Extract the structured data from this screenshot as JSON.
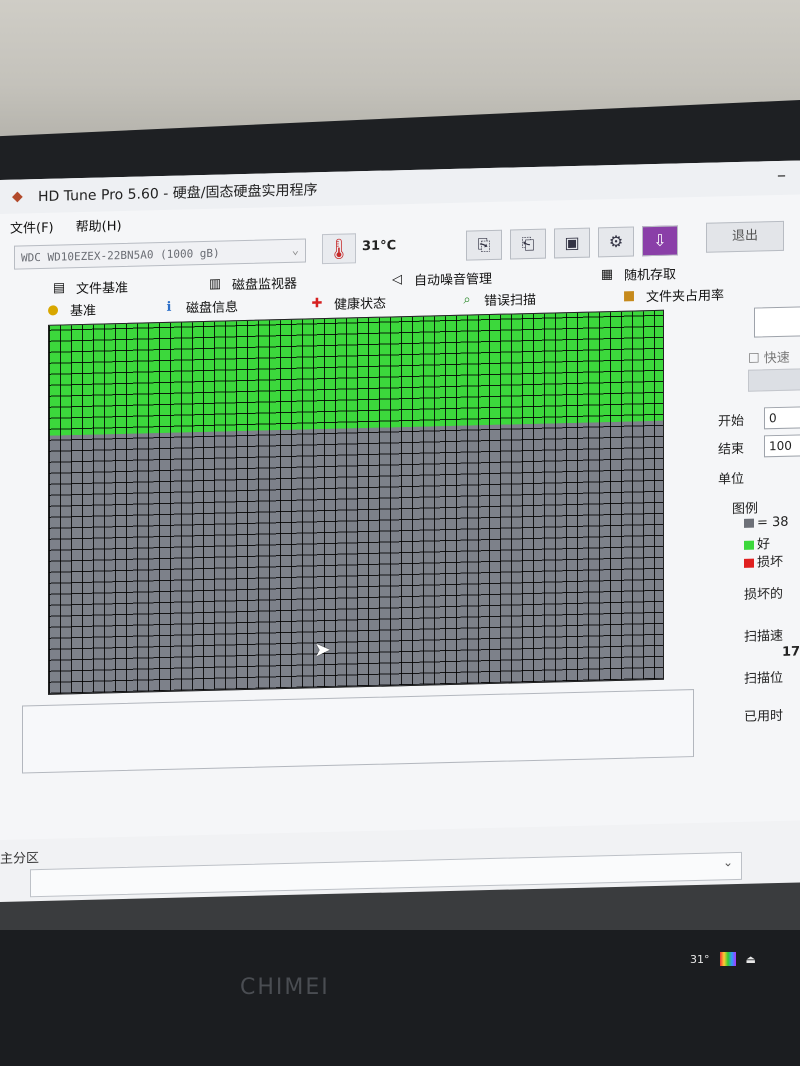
{
  "window": {
    "title": "HD Tune Pro 5.60 - 硬盘/固态硬盘实用程序",
    "menu": [
      "文件(F)",
      "帮助(H)"
    ]
  },
  "toolbar": {
    "drive": "WDC WD10EZEX-22BN5A0  (1000 gB)",
    "temperature": "31°C",
    "exit_label": "退出"
  },
  "tabs": {
    "row1": [
      "文件基准",
      "磁盘监视器",
      "自动噪音管理",
      "随机存取"
    ],
    "row2": [
      "基准",
      "磁盘信息",
      "健康状态",
      "错误扫描",
      "文件夹占用率"
    ]
  },
  "scan": {
    "progress_fraction": 0.3
  },
  "side": {
    "quick_scan": "快速",
    "start_label": "开始",
    "start_value": "0",
    "end_label": "结束",
    "end_value": "100",
    "unit_label": "单位",
    "legend_title": "图例",
    "legend_block": "= 38",
    "legend_good": "好",
    "legend_bad": "损坏",
    "damaged": "损坏的",
    "scan_speed": "扫描速",
    "scan_speed_value": "17",
    "scan_pos": "扫描位",
    "elapsed": "已用时"
  },
  "bottom": {
    "partition": "主分区"
  },
  "monitor": {
    "brand": "CHIMEI",
    "tray_temp": "31°"
  }
}
